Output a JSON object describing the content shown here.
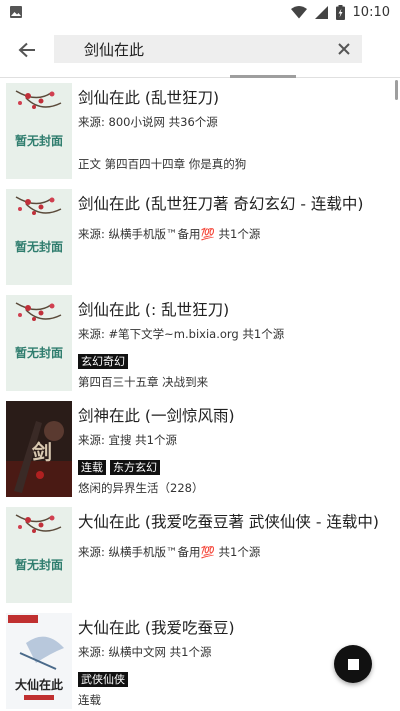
{
  "status_bar": {
    "time": "10:10",
    "icons": [
      "image-icon",
      "wifi-icon",
      "signal-icon",
      "battery-icon"
    ]
  },
  "search": {
    "query": "剑仙在此",
    "back_icon": "arrow-left-icon",
    "clear_icon": "close-icon"
  },
  "results": [
    {
      "title": "剑仙在此 (乱世狂刀)",
      "source": "来源: 800小说网  共36个源",
      "tags": [],
      "extra": "正文 第四百四十四章 你是真的狗",
      "cover": "placeholder"
    },
    {
      "title": "剑仙在此 (乱世狂刀著 奇幻玄幻 - 连载中)",
      "source": "来源: 纵横手机版™备用💯 共1个源",
      "tags": [],
      "extra": "",
      "cover": "placeholder"
    },
    {
      "title": "剑仙在此 (:  乱世狂刀)",
      "source": "来源: #笔下文学~m.bixia.org  共1个源",
      "tags": [
        "玄幻奇幻"
      ],
      "extra": "第四百三十五章 决战到来",
      "cover": "placeholder"
    },
    {
      "title": "剑神在此 (一剑惊风雨)",
      "source": "来源: 宜搜  共1个源",
      "tags": [
        "连载",
        "东方玄幻"
      ],
      "extra": "悠闲的异界生活（228）",
      "cover": "dark"
    },
    {
      "title": "大仙在此 (我爱吃蚕豆著 武侠仙侠 - 连载中)",
      "source": "来源: 纵横手机版™备用💯 共1个源",
      "tags": [],
      "extra": "",
      "cover": "placeholder"
    },
    {
      "title": "大仙在此 (我爱吃蚕豆)",
      "source": "来源: 纵横中文网  共1个源",
      "tags": [
        "武侠仙侠"
      ],
      "extra": "连载",
      "cover": "white"
    }
  ],
  "covers": {
    "placeholder_text": "暂无封面",
    "dark_text": "剑",
    "white_text": "大仙在此"
  },
  "fab_icon": "stop-icon",
  "colors": {
    "accent": "#111111",
    "search_bg": "#eeeeee",
    "tag_bg": "#111111"
  }
}
